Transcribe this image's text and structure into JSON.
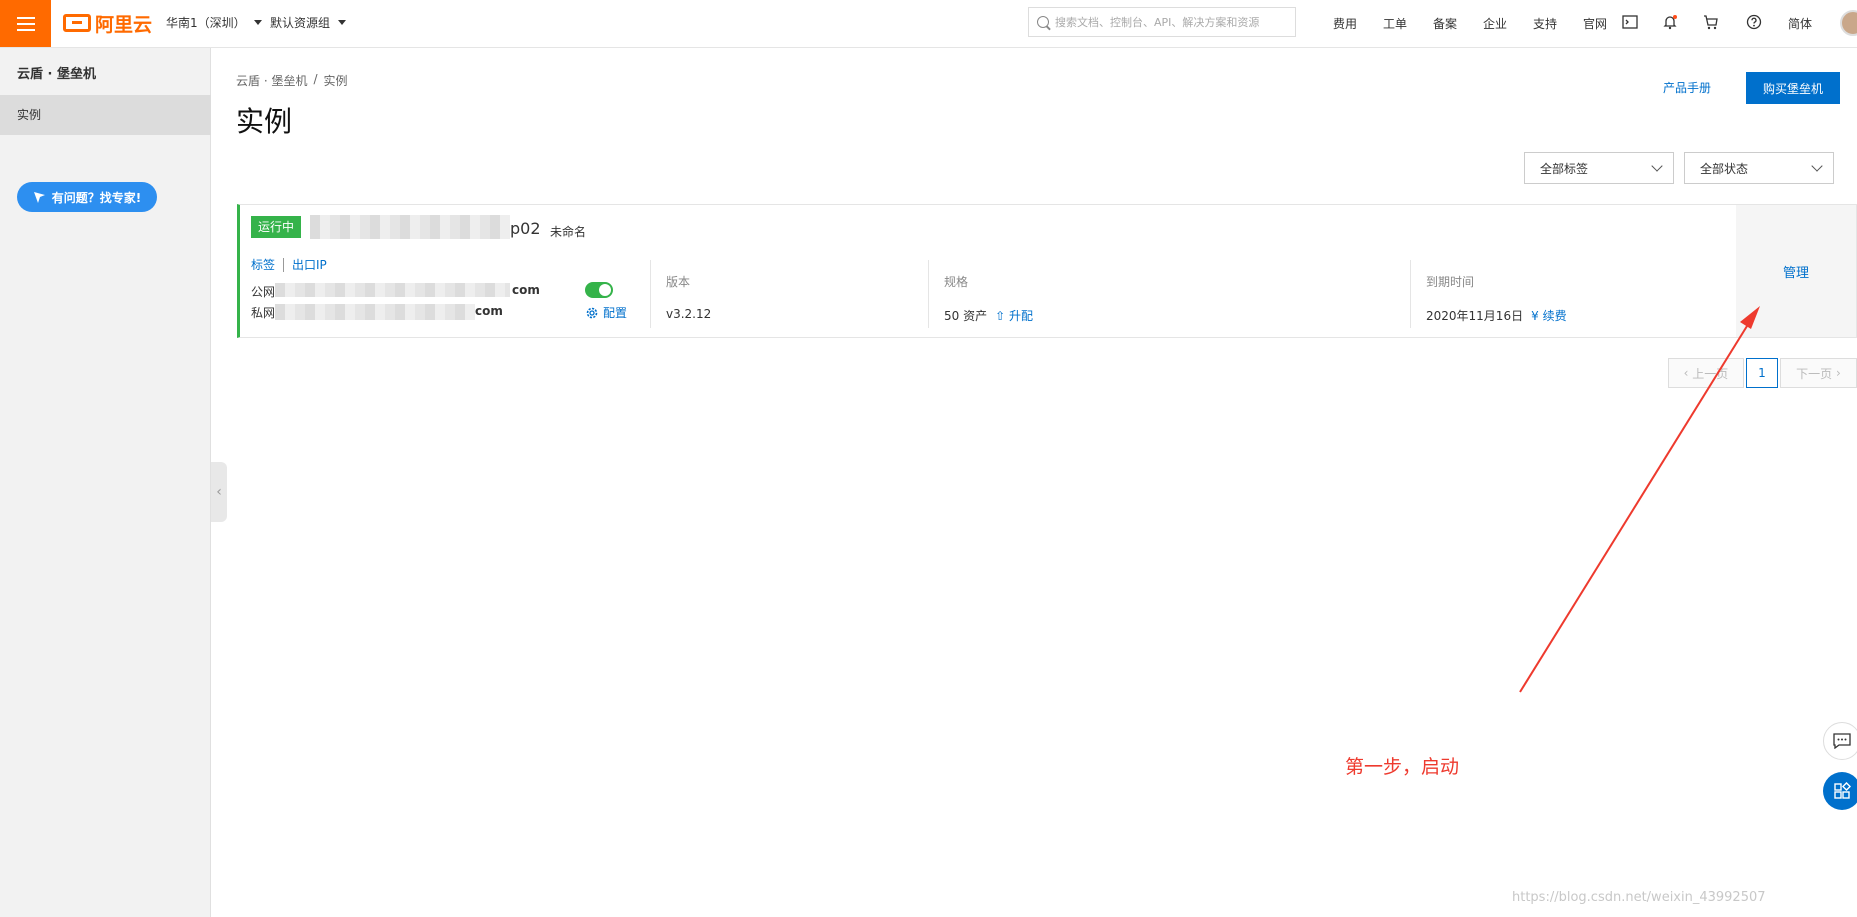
{
  "topbar": {
    "logo": "阿里云",
    "region": "华南1（深圳）",
    "resource_group": "默认资源组",
    "search_placeholder": "搜索文档、控制台、API、解决方案和资源",
    "links": [
      "费用",
      "工单",
      "备案",
      "企业",
      "支持",
      "官网"
    ],
    "language": "简体",
    "icons": [
      "terminal-icon",
      "bell-icon",
      "cart-icon",
      "help-icon"
    ]
  },
  "sidebar": {
    "title": "云盾 · 堡垒机",
    "items": [
      {
        "label": "实例",
        "active": true
      }
    ],
    "expert_button": "有问题？找专家!"
  },
  "main": {
    "breadcrumb": [
      "云盾 · 堡垒机",
      "/",
      "实例"
    ],
    "title": "实例",
    "doc_link": "产品手册",
    "buy_button": "购买堡垒机",
    "filters": [
      "全部标签",
      "全部状态"
    ]
  },
  "instance": {
    "status": "运行中",
    "name_suffix": "p02",
    "alias": "未命名",
    "links": [
      "标签",
      "出口IP"
    ],
    "public_label": "公网",
    "public_suffix": "com",
    "private_label": "私网",
    "private_suffix": "com",
    "config_label": "配置",
    "version_label": "版本",
    "version_value": "v3.2.12",
    "spec_label": "规格",
    "spec_value": "50 资产",
    "upgrade_link": "升配",
    "expiry_label": "到期时间",
    "expiry_value": "2020年11月16日",
    "renew_link": "续费",
    "manage_link": "管理"
  },
  "pagination": {
    "prev": "上一页",
    "current": "1",
    "next": "下一页"
  },
  "annotation": {
    "text": "第一步，启动",
    "color": "#ee3a2e"
  },
  "watermark": "https://blog.csdn.net/weixin_43992507",
  "colors": {
    "brand_orange": "#ff6a00",
    "primary_blue": "#0070cc",
    "running_green": "#35b34a"
  }
}
